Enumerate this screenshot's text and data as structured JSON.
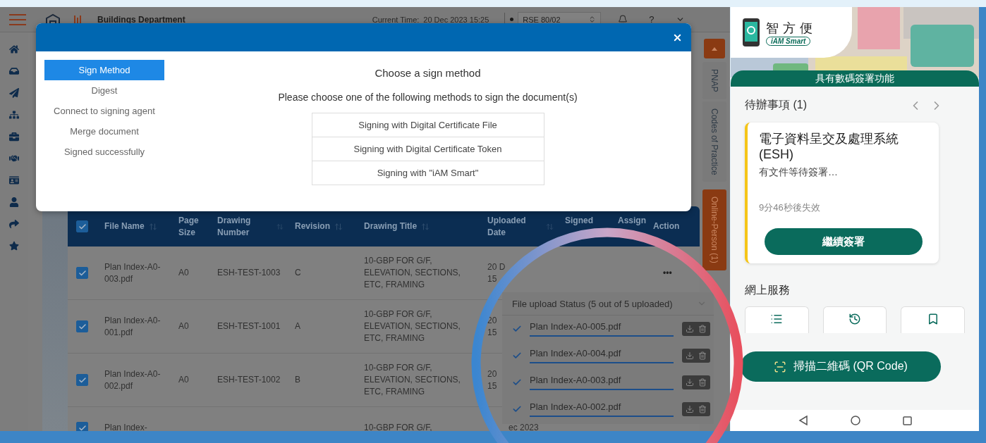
{
  "app": {
    "title": "Buildings Department",
    "time_label": "Current Time:",
    "time": "20 Dec 2023 15:25",
    "account": "RSE 80/02",
    "help": "?"
  },
  "side_tabs": [
    {
      "label": "PNAP",
      "selected": false
    },
    {
      "label": "Codes of Practice",
      "selected": false
    },
    {
      "label": "Online-Person (1)",
      "selected": true
    }
  ],
  "table": {
    "select_all": {
      "checked": true
    },
    "columns": [
      {
        "label": "File Name",
        "sortable": true
      },
      {
        "label": "Page Size",
        "sortable": false
      },
      {
        "label": "Drawing Number",
        "sortable": true
      },
      {
        "label": "Revision",
        "sortable": true
      },
      {
        "label": "Drawing Title",
        "sortable": true
      },
      {
        "label": "Uploaded Date",
        "sortable": true
      },
      {
        "label": "Signed",
        "sortable": false
      },
      {
        "label": "Assign",
        "sortable": false
      },
      {
        "label": "Action",
        "sortable": false
      }
    ],
    "rows": [
      {
        "checked": true,
        "file_name": "Plan Index-A0-003.pdf",
        "page_size": "A0",
        "drawing_number": "ESH-TEST-1003",
        "revision": "C",
        "drawing_title": "10-GBP FOR G/F, ELEVATION, SECTIONS, ETC, FRAMING",
        "uploaded": [
          "20 D",
          "15"
        ],
        "action": "•••"
      },
      {
        "checked": true,
        "file_name": "Plan Index-A0-001.pdf",
        "page_size": "A0",
        "drawing_number": "ESH-TEST-1001",
        "revision": "A",
        "drawing_title": "10-GBP FOR G/F, ELEVATION, SECTIONS, ETC, FRAMING",
        "uploaded": [
          "20",
          "15"
        ]
      },
      {
        "checked": true,
        "file_name": "Plan Index-A0-002.pdf",
        "page_size": "A0",
        "drawing_number": "ESH-TEST-1002",
        "revision": "B",
        "drawing_title": "10-GBP FOR G/F, ELEVATION, SECTIONS, ETC, FRAMING",
        "uploaded": [
          "20",
          "15"
        ]
      },
      {
        "checked": true,
        "file_name": "Plan Index-",
        "drawing_title": "10-GBP FOR G/F,",
        "uploaded": [
          "ec 2023"
        ]
      }
    ]
  },
  "modal": {
    "steps": [
      {
        "label": "Sign Method",
        "selected": true
      },
      {
        "label": "Digest",
        "selected": false
      },
      {
        "label": "Connect to signing agent",
        "selected": false
      },
      {
        "label": "Merge document",
        "selected": false
      },
      {
        "label": "Signed successfully",
        "selected": false
      }
    ],
    "heading": "Choose a sign method",
    "instruction": "Please choose one of the following methods to sign the document(s)",
    "methods": [
      "Signing with Digital Certificate File",
      "Signing with Digital Certificate Token",
      "Signing with \"iAM Smart\""
    ]
  },
  "upload_status": {
    "title": "File upload Status (5 out of 5 uploaded)",
    "files": [
      {
        "name": "Plan Index-A0-005.pdf",
        "done": true
      },
      {
        "name": "Plan Index-A0-004.pdf",
        "done": true
      },
      {
        "name": "Plan Index-A0-003.pdf",
        "done": true
      },
      {
        "name": "Plan Index-A0-002.pdf",
        "done": true
      }
    ]
  },
  "phone": {
    "logo_text": "智方便",
    "logo_subtitle": "iAM Smart",
    "banner": "具有數碼簽署功能",
    "todo_title": "待辦事項 (1)",
    "task": {
      "title": "電子資料呈交及處理系統 (ESH)",
      "subtitle": "有文件等待簽署…",
      "expiry": "9分46秒後失效",
      "action": "繼續簽署"
    },
    "services_title": "網上服務",
    "service_tiles": [
      {
        "kind": "list"
      },
      {
        "kind": "history"
      },
      {
        "kind": "bookmark"
      }
    ],
    "scan_button": "掃描二維碼 (QR Code)"
  }
}
